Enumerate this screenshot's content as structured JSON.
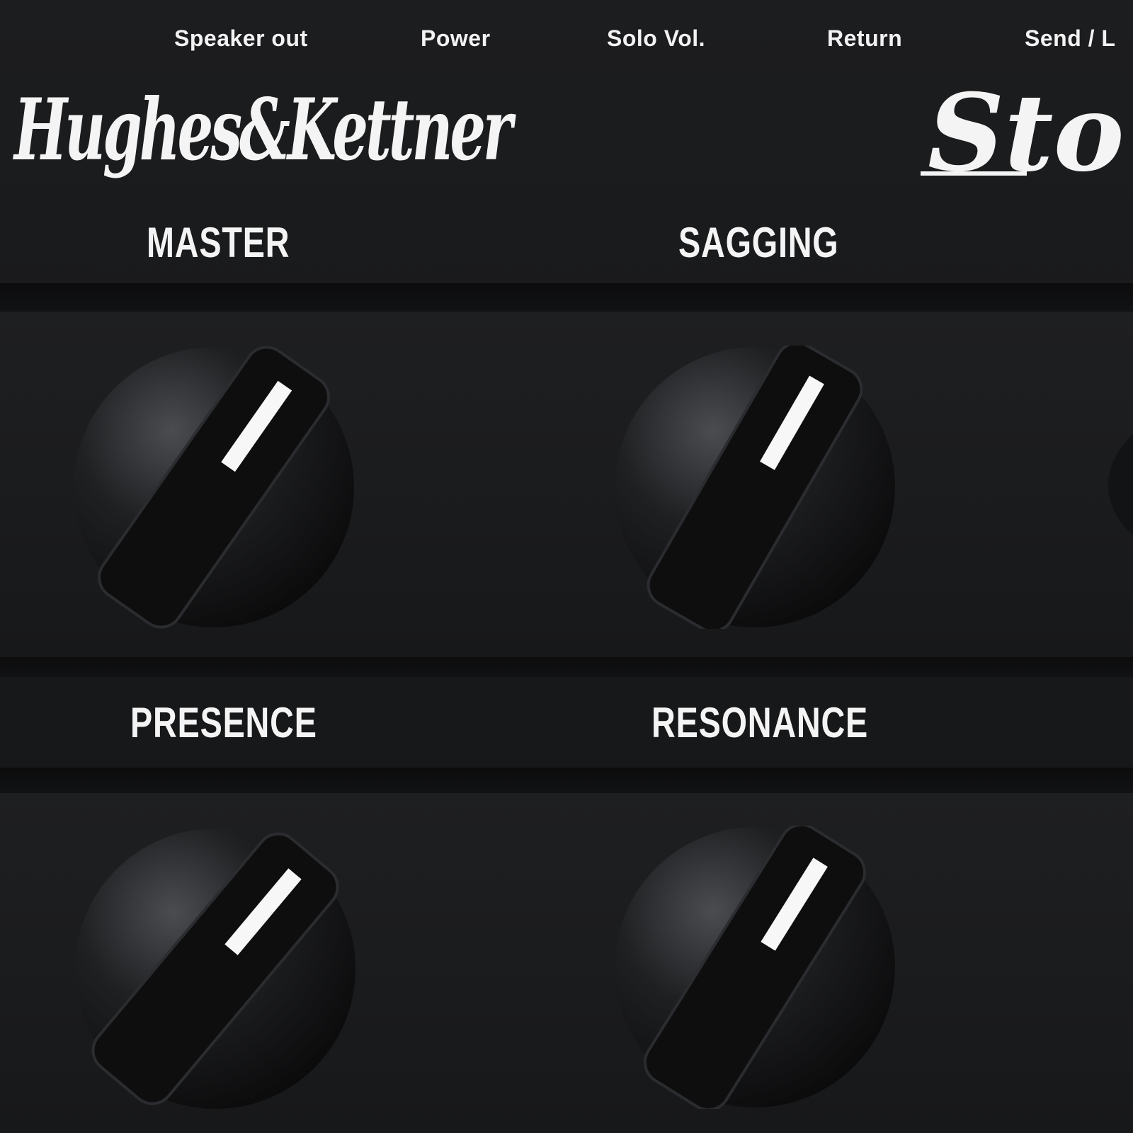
{
  "panel": {
    "jack_labels": [
      "Speaker out",
      "Power",
      "Solo Vol.",
      "Return",
      "Send / L"
    ],
    "brand_logo_text": "Hughes&Kettner",
    "model_logo_text": "Sto"
  },
  "controls": [
    {
      "label": "MASTER"
    },
    {
      "label": "SAGGING"
    },
    {
      "label": "PRESENCE"
    },
    {
      "label": "RESONANCE"
    }
  ],
  "colors": {
    "panel": "#18191b",
    "print": "#f2f2f2",
    "knob": "#1a1b1d",
    "pointer": "#ffffff"
  }
}
